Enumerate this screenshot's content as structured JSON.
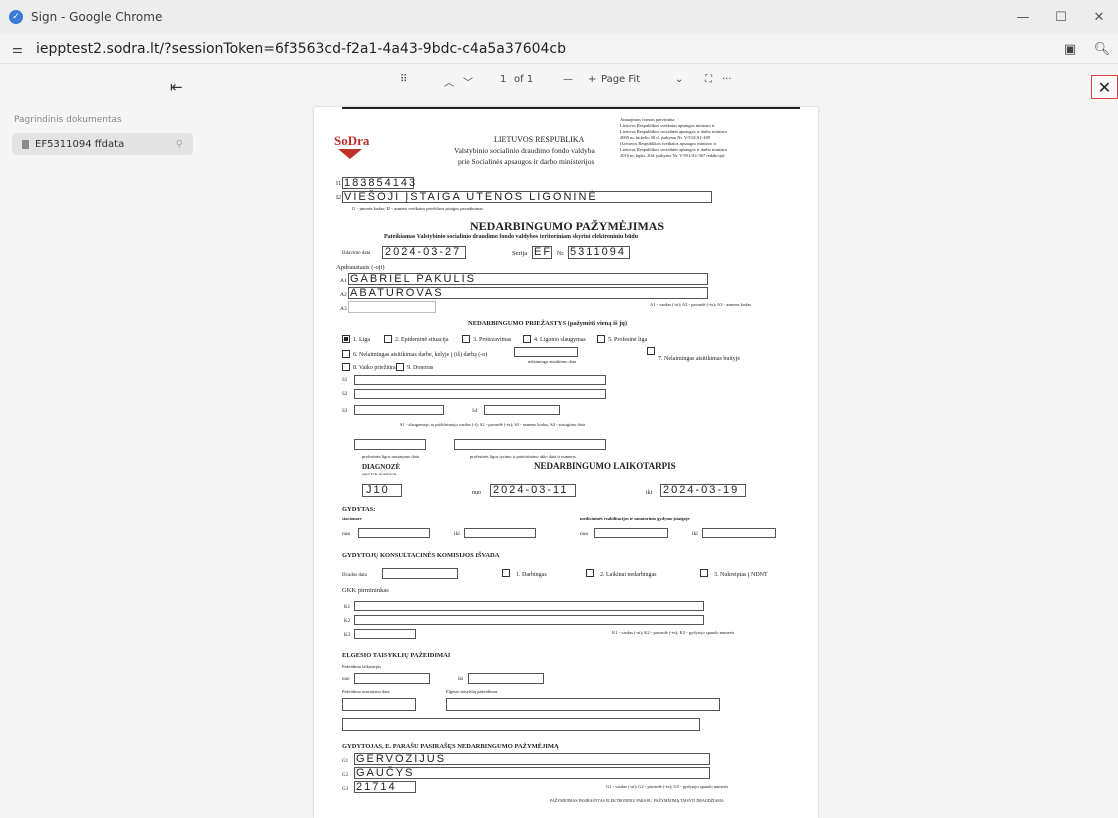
{
  "window": {
    "title": "Sign - Google Chrome",
    "min": "—",
    "max": "☐",
    "close": "✕"
  },
  "url": {
    "text": "iepptest2.sodra.lt/?sessionToken=6f3563cd-f2a1-4a43-9bdc-c4a5a37604cb"
  },
  "sidebar": {
    "heading": "Pagrindinis dokumentas",
    "item": "EF5311094 ffdata"
  },
  "pdf_toolbar": {
    "grid": "⠿",
    "page": "1",
    "of": "of 1",
    "minus": "—",
    "plus": "+",
    "zoom": "Page Fit",
    "more": "···"
  },
  "doc": {
    "logo": "SoDra",
    "h1": "LIETUVOS RESPUBLIKA",
    "h2": "Valstybinio socialinio draudimo fondo valdyba",
    "h3": "prie Socialinės apsaugos ir darbo ministerijos",
    "approval": [
      "Atnaujintos formos patvirtinta",
      "Lietuvos Respublikos sveikatos apsaugos ministro ir",
      "Lietuvos Respublikos socialinės apsaugos ir darbo ministro",
      "2005 m. birželio 30 d. įsakymu Nr. V-533/A1-189",
      "(Lietuvos Respublikos sveikatos apsaugos ministro ir",
      "Lietuvos Respublikos socialinės apsaugos ir darbo ministro",
      "2016 m. lapkr. 20d. įsakymo Nr. V-951/A1-367 redakcija)"
    ],
    "i1": "183854143",
    "i2": "VIEŠOJI ĮSTAIGA UTENOS LIGONINĖ",
    "inote": "I1 - įmonės kodas; I2 - asmens sveikatos priežiūros įstaigos pavadinimas",
    "title": "NEDARBINGUMO PAŽYMĖJIMAS",
    "subtitle": "Pateikiamas Valstybinio socialinio draudimo fondo valdybos teritoriniam skyriui elektroniniu būdu",
    "issue_label": "Išdavimo data",
    "issue_date": "2024-03-27",
    "series_label": "Serija",
    "series": "EF",
    "nr_label": "Nr.",
    "nr": "5311094",
    "insured_label": "Apdraustasis (-oji)",
    "a1": "GABRIEL PAKULIS",
    "a2": "ABATUROVAS",
    "a3_note": "A1 - vardas (-ai); A2 - pavardė (-ės); A3 - asmens kodas",
    "cause_title": "NEDARBINGUMO PRIEŽASTYS (pažymėti vieną iš jų)",
    "causes": [
      "1. Liga",
      "2. Epideminė situacija",
      "3. Protezavimas",
      "4. Ligonio slaugymas",
      "5. Profesinė liga",
      "6. Nelaimingas atsitikimas darbe, kelyje į (iš) darbą (-o)",
      "7. Nelaimingas atsitikimas buityje",
      "8. Vaiko priežiūra",
      "9. Donoras"
    ],
    "accident_date": "nelaimingo atsitikimo data",
    "s_note": "S1 - slaugomojo ar prižiūrimojo vardas (-i); S2 - pavardė (-ės); S3 - asmens kodas; S4 - susirgimo data",
    "pl_date": "profesinės ligos nustatymo data",
    "pl_act": "profesinės ligos tyrimo ir patvirtinimo akto data ir numeris",
    "diag_title": "DIAGNOZĖ",
    "diag_sub": "pagal TLK-10-AM kodą",
    "diag": "J10",
    "period_title": "NEDARBINGUMO LAIKOTARPIS",
    "from": "nuo",
    "to": "iki",
    "period_from": "2024-03-11",
    "period_to": "2024-03-19",
    "doctor_title": "GYDYTAS:",
    "stationary": "stacionare",
    "rehab": "medicininės reabilitacijos ir sanatorinio gydymo įstaigoje",
    "gkk_title": "GYDYTOJŲ KONSULTACINĖS KOMISIJOS IŠVADA",
    "gkk_date": "Išvados data",
    "gkk_opts": [
      "1. Darbingas",
      "2. Laikinai nedarbingas",
      "3. Nukreiptas į NDNT"
    ],
    "gkk_chair": "GKK pirmininkas",
    "k_note": "K1 - vardas (-ai); K2 - pavardė (-ės); K3 - gydytojo spaudo numeris",
    "viol_title": "ELGESIO TAISYKLIŲ PAŽEIDIMAI",
    "viol_period": "Pažeidimo laikotarpis",
    "viol_date": "Pažeidimo nustatymo data",
    "viol_name": "Elgesio taisyklių pažeidimas",
    "sign_title": "GYDYTOJAS, E. PARAŠU PASIRAŠĘS NEDARBINGUMO PAŽYMĖJIMĄ",
    "g1": "GERVOZIJUS",
    "g2": "GAUČYS",
    "g3": "21714",
    "g_note": "G1 - vardas (-ai); G2 - pavardė (-ės); G3 - gydytojo spaudo numeris",
    "footer": "PAŽYMĖJIMAS PASIRAŠYTAS ELEKTRONINIU PARAŠU. PAŽYMĖJIMĄ TAISYTI DRAUDŽIAMA"
  }
}
